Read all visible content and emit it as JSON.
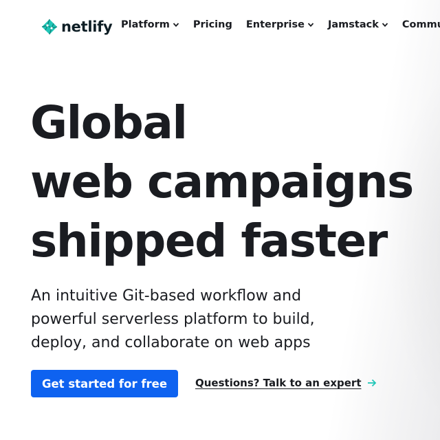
{
  "brand": {
    "name": "netlify",
    "logo_icon": "netlify-logo-icon",
    "logo_color": "#20c6b7"
  },
  "nav": {
    "items": [
      {
        "label": "Platform",
        "has_dropdown": true
      },
      {
        "label": "Pricing",
        "has_dropdown": false
      },
      {
        "label": "Enterprise",
        "has_dropdown": true
      },
      {
        "label": "Jamstack",
        "has_dropdown": true
      },
      {
        "label": "Community",
        "has_dropdown": true
      }
    ]
  },
  "hero": {
    "title_lines": [
      "Global",
      "web campaigns",
      "shipped faster"
    ],
    "subtitle_lines": [
      "An intuitive Git-based workflow and",
      "powerful serverless platform to build,",
      "deploy, and collaborate on web apps"
    ],
    "primary_cta": "Get started for free",
    "secondary_cta": "Questions? Talk to an expert",
    "secondary_cta_icon": "arrow-right-icon"
  },
  "colors": {
    "primary": "#0e62f0",
    "text": "#1a1c21",
    "accent": "#20c6b7"
  }
}
